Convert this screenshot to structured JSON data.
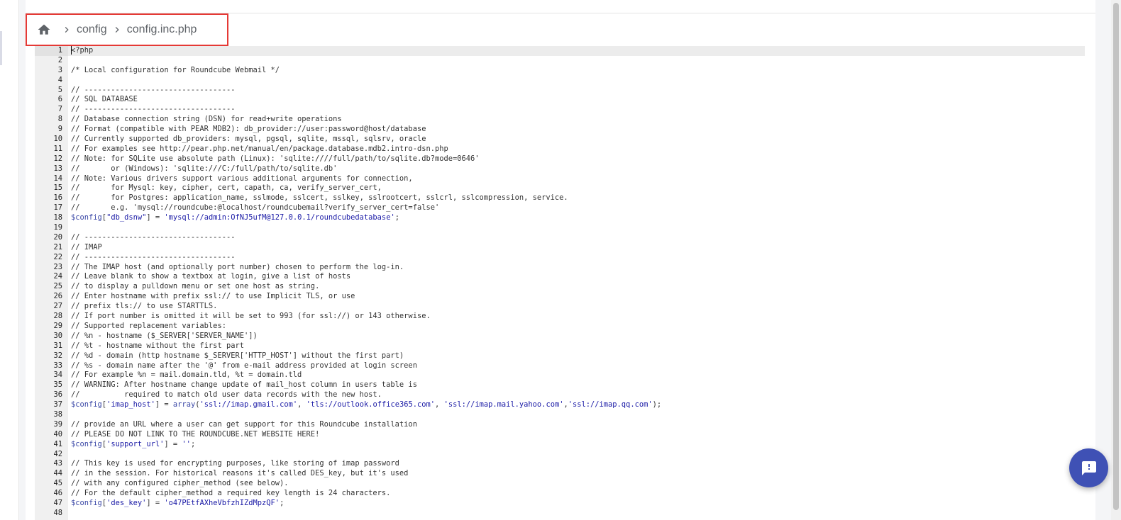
{
  "breadcrumb": {
    "items": [
      "config",
      "config.inc.php"
    ]
  },
  "editor": {
    "active_line": 1,
    "lines": [
      {
        "n": "1",
        "segs": [
          {
            "t": "<?php",
            "c": "op"
          }
        ]
      },
      {
        "n": "2",
        "segs": []
      },
      {
        "n": "3",
        "segs": [
          {
            "t": "/* Local configuration for Roundcube Webmail */",
            "c": "cmt"
          }
        ]
      },
      {
        "n": "4",
        "segs": []
      },
      {
        "n": "5",
        "segs": [
          {
            "t": "// ----------------------------------",
            "c": "cmt"
          }
        ]
      },
      {
        "n": "6",
        "segs": [
          {
            "t": "// SQL DATABASE",
            "c": "cmt"
          }
        ]
      },
      {
        "n": "7",
        "segs": [
          {
            "t": "// ----------------------------------",
            "c": "cmt"
          }
        ]
      },
      {
        "n": "8",
        "segs": [
          {
            "t": "// Database connection string (DSN) for read+write operations",
            "c": "cmt"
          }
        ]
      },
      {
        "n": "9",
        "segs": [
          {
            "t": "// Format (compatible with PEAR MDB2): db_provider://user:password@host/database",
            "c": "cmt"
          }
        ]
      },
      {
        "n": "10",
        "segs": [
          {
            "t": "// Currently supported db_providers: mysql, pgsql, sqlite, mssql, sqlsrv, oracle",
            "c": "cmt"
          }
        ]
      },
      {
        "n": "11",
        "segs": [
          {
            "t": "// For examples see http://pear.php.net/manual/en/package.database.mdb2.intro-dsn.php",
            "c": "cmt"
          }
        ]
      },
      {
        "n": "12",
        "segs": [
          {
            "t": "// Note: for SQLite use absolute path (Linux): 'sqlite:////full/path/to/sqlite.db?mode=0646'",
            "c": "cmt"
          }
        ]
      },
      {
        "n": "13",
        "segs": [
          {
            "t": "//       or (Windows): 'sqlite:///C:/full/path/to/sqlite.db'",
            "c": "cmt"
          }
        ]
      },
      {
        "n": "14",
        "segs": [
          {
            "t": "// Note: Various drivers support various additional arguments for connection,",
            "c": "cmt"
          }
        ]
      },
      {
        "n": "15",
        "segs": [
          {
            "t": "//       for Mysql: key, cipher, cert, capath, ca, verify_server_cert,",
            "c": "cmt"
          }
        ]
      },
      {
        "n": "16",
        "segs": [
          {
            "t": "//       for Postgres: application_name, sslmode, sslcert, sslkey, sslrootcert, sslcrl, sslcompression, service.",
            "c": "cmt"
          }
        ]
      },
      {
        "n": "17",
        "segs": [
          {
            "t": "//       e.g. 'mysql://roundcube:@localhost/roundcubemail?verify_server_cert=false'",
            "c": "cmt"
          }
        ]
      },
      {
        "n": "18",
        "segs": [
          {
            "t": "$config",
            "c": "var"
          },
          {
            "t": "[",
            "c": "op"
          },
          {
            "t": "\"db_dsnw\"",
            "c": "str"
          },
          {
            "t": "] = ",
            "c": "op"
          },
          {
            "t": "'mysql://admin:OfNJ5ufM@127.0.0.1/roundcubedatabase'",
            "c": "str"
          },
          {
            "t": ";",
            "c": "op"
          }
        ]
      },
      {
        "n": "19",
        "segs": []
      },
      {
        "n": "20",
        "segs": [
          {
            "t": "// ----------------------------------",
            "c": "cmt"
          }
        ]
      },
      {
        "n": "21",
        "segs": [
          {
            "t": "// IMAP",
            "c": "cmt"
          }
        ]
      },
      {
        "n": "22",
        "segs": [
          {
            "t": "// ----------------------------------",
            "c": "cmt"
          }
        ]
      },
      {
        "n": "23",
        "segs": [
          {
            "t": "// The IMAP host (and optionally port number) chosen to perform the log-in.",
            "c": "cmt"
          }
        ]
      },
      {
        "n": "24",
        "segs": [
          {
            "t": "// Leave blank to show a textbox at login, give a list of hosts",
            "c": "cmt"
          }
        ]
      },
      {
        "n": "25",
        "segs": [
          {
            "t": "// to display a pulldown menu or set one host as string.",
            "c": "cmt"
          }
        ]
      },
      {
        "n": "26",
        "segs": [
          {
            "t": "// Enter hostname with prefix ssl:// to use Implicit TLS, or use",
            "c": "cmt"
          }
        ]
      },
      {
        "n": "27",
        "segs": [
          {
            "t": "// prefix tls:// to use STARTTLS.",
            "c": "cmt"
          }
        ]
      },
      {
        "n": "28",
        "segs": [
          {
            "t": "// If port number is omitted it will be set to 993 (for ssl://) or 143 otherwise.",
            "c": "cmt"
          }
        ]
      },
      {
        "n": "29",
        "segs": [
          {
            "t": "// Supported replacement variables:",
            "c": "cmt"
          }
        ]
      },
      {
        "n": "30",
        "segs": [
          {
            "t": "// %n - hostname ($_SERVER['SERVER_NAME'])",
            "c": "cmt"
          }
        ]
      },
      {
        "n": "31",
        "segs": [
          {
            "t": "// %t - hostname without the first part",
            "c": "cmt"
          }
        ]
      },
      {
        "n": "32",
        "segs": [
          {
            "t": "// %d - domain (http hostname $_SERVER['HTTP_HOST'] without the first part)",
            "c": "cmt"
          }
        ]
      },
      {
        "n": "33",
        "segs": [
          {
            "t": "// %s - domain name after the '@' from e-mail address provided at login screen",
            "c": "cmt"
          }
        ]
      },
      {
        "n": "34",
        "segs": [
          {
            "t": "// For example %n = mail.domain.tld, %t = domain.tld",
            "c": "cmt"
          }
        ]
      },
      {
        "n": "35",
        "segs": [
          {
            "t": "// WARNING: After hostname change update of mail_host column in users table is",
            "c": "cmt"
          }
        ]
      },
      {
        "n": "36",
        "segs": [
          {
            "t": "//          required to match old user data records with the new host.",
            "c": "cmt"
          }
        ]
      },
      {
        "n": "37",
        "segs": [
          {
            "t": "$config",
            "c": "var"
          },
          {
            "t": "[",
            "c": "op"
          },
          {
            "t": "'imap_host'",
            "c": "str"
          },
          {
            "t": "] = ",
            "c": "op"
          },
          {
            "t": "array",
            "c": "var"
          },
          {
            "t": "(",
            "c": "op"
          },
          {
            "t": "'ssl://imap.gmail.com'",
            "c": "str"
          },
          {
            "t": ", ",
            "c": "op"
          },
          {
            "t": "'tls://outlook.office365.com'",
            "c": "str"
          },
          {
            "t": ", ",
            "c": "op"
          },
          {
            "t": "'ssl://imap.mail.yahoo.com'",
            "c": "str"
          },
          {
            "t": ",",
            "c": "op"
          },
          {
            "t": "'ssl://imap.qq.com'",
            "c": "str"
          },
          {
            "t": ");",
            "c": "op"
          }
        ]
      },
      {
        "n": "38",
        "segs": []
      },
      {
        "n": "39",
        "segs": [
          {
            "t": "// provide an URL where a user can get support for this Roundcube installation",
            "c": "cmt"
          }
        ]
      },
      {
        "n": "40",
        "segs": [
          {
            "t": "// PLEASE DO NOT LINK TO THE ROUNDCUBE.NET WEBSITE HERE!",
            "c": "cmt"
          }
        ]
      },
      {
        "n": "41",
        "segs": [
          {
            "t": "$config",
            "c": "var"
          },
          {
            "t": "[",
            "c": "op"
          },
          {
            "t": "'support_url'",
            "c": "str"
          },
          {
            "t": "] = ",
            "c": "op"
          },
          {
            "t": "''",
            "c": "str"
          },
          {
            "t": ";",
            "c": "op"
          }
        ]
      },
      {
        "n": "42",
        "segs": []
      },
      {
        "n": "43",
        "segs": [
          {
            "t": "// This key is used for encrypting purposes, like storing of imap password",
            "c": "cmt"
          }
        ]
      },
      {
        "n": "44",
        "segs": [
          {
            "t": "// in the session. For historical reasons it's called DES_key, but it's used",
            "c": "cmt"
          }
        ]
      },
      {
        "n": "45",
        "segs": [
          {
            "t": "// with any configured cipher_method (see below).",
            "c": "cmt"
          }
        ]
      },
      {
        "n": "46",
        "segs": [
          {
            "t": "// For the default cipher_method a required key length is 24 characters.",
            "c": "cmt"
          }
        ]
      },
      {
        "n": "47",
        "segs": [
          {
            "t": "$config",
            "c": "var"
          },
          {
            "t": "[",
            "c": "op"
          },
          {
            "t": "'des_key'",
            "c": "str"
          },
          {
            "t": "] = ",
            "c": "op"
          },
          {
            "t": "'o47PEtfAXheVbfzhIZdMpzQF'",
            "c": "str"
          },
          {
            "t": ";",
            "c": "op"
          }
        ]
      },
      {
        "n": "48",
        "segs": []
      }
    ]
  },
  "fab": {
    "icon": "feedback-icon",
    "color": "#3f51b5"
  }
}
